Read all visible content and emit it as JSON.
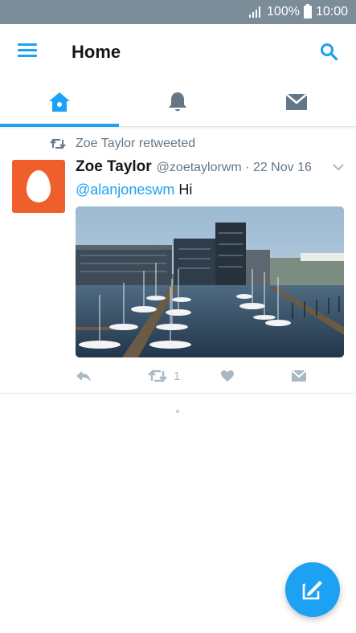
{
  "status_bar": {
    "battery": "100%",
    "time": "10:00"
  },
  "app_bar": {
    "title": "Home"
  },
  "tabs": [
    {
      "name": "home",
      "icon": "home-icon",
      "selected": true
    },
    {
      "name": "notifications",
      "icon": "bell-icon",
      "selected": false
    },
    {
      "name": "messages",
      "icon": "envelope-icon",
      "selected": false
    }
  ],
  "tweet": {
    "retweeted_by": "Zoe Taylor retweeted",
    "author_name": "Zoe Taylor",
    "author_meta": "@zoetaylorwm · 22 Nov 16",
    "mention": "@alanjoneswm",
    "text": " Hi",
    "retweet_count": "1",
    "image_description_icon": "harbor-photo"
  },
  "colors": {
    "accent": "#1da1f2",
    "status_bar": "#7b8d99",
    "avatar": "#f05f2b",
    "muted": "#657786",
    "action_icon": "#aab8c2"
  }
}
